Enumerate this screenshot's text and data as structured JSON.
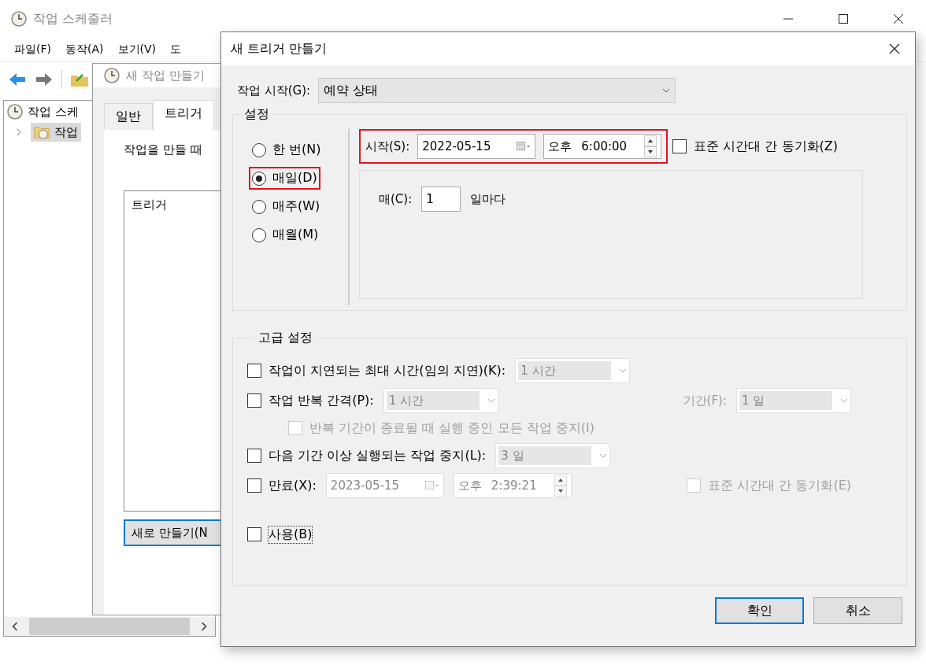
{
  "main_window": {
    "title": "작업 스케줄러",
    "menu": [
      "파일(F)",
      "동작(A)",
      "보기(V)",
      "도"
    ],
    "tree": [
      {
        "label": "작업 스케",
        "children": [
          {
            "label": "작업",
            "expanded": false,
            "selected": true
          }
        ]
      }
    ]
  },
  "task_window": {
    "title": "새 작업 만들기",
    "tabs": [
      {
        "label": "일반",
        "selected": false
      },
      {
        "label": "트리거",
        "selected": true
      }
    ],
    "description": "작업을 만들 때",
    "list_header": "트리거",
    "new_button": "새로 만들기(N"
  },
  "trigger_dialog": {
    "title": "새 트리거 만들기",
    "begin": {
      "label": "작업 시작(G):",
      "value": "예약 상태"
    },
    "settings": {
      "title": "설정",
      "schedules": [
        {
          "label": "한 번(N)",
          "selected": false,
          "highlighted": false
        },
        {
          "label": "매일(D)",
          "selected": true,
          "highlighted": true
        },
        {
          "label": "매주(W)",
          "selected": false,
          "highlighted": false
        },
        {
          "label": "매월(M)",
          "selected": false,
          "highlighted": false
        }
      ],
      "start": {
        "label": "시작(S):",
        "date": "2022-05-15",
        "ampm": "오후",
        "time": "6:00:00",
        "highlighted": true
      },
      "sync": {
        "label": "표준 시간대 간 동기화(Z)",
        "checked": false
      },
      "recur": {
        "label": "매(C):",
        "value": "1",
        "unit": "일마다"
      }
    },
    "advanced": {
      "title": "고급 설정",
      "delay": {
        "label": "작업이 지연되는 최대 시간(임의 지연)(K):",
        "checked": false,
        "value": "1 시간"
      },
      "repeat": {
        "label": "작업 반복 간격(P):",
        "checked": false,
        "value": "1 시간",
        "duration_label": "기간(F):",
        "duration": "1 일"
      },
      "stop_all": {
        "label": "반복 기간이 종료될 때 실행 중인 모든 작업 중지(I)",
        "checked": false,
        "disabled": true
      },
      "stop_after": {
        "label": "다음 기간 이상 실행되는 작업 중지(L):",
        "checked": false,
        "value": "3 일"
      },
      "expire": {
        "label": "만료(X):",
        "checked": false,
        "date": "2023-05-15",
        "ampm": "오후",
        "time": "2:39:21",
        "sync_label": "표준 시간대 간 동기화(E)",
        "sync_checked": false,
        "sync_disabled": true
      },
      "enabled": {
        "label": "사용(B)",
        "checked": false
      }
    },
    "buttons": [
      {
        "label": "확인",
        "default": true
      },
      {
        "label": "취소",
        "default": false
      }
    ]
  }
}
